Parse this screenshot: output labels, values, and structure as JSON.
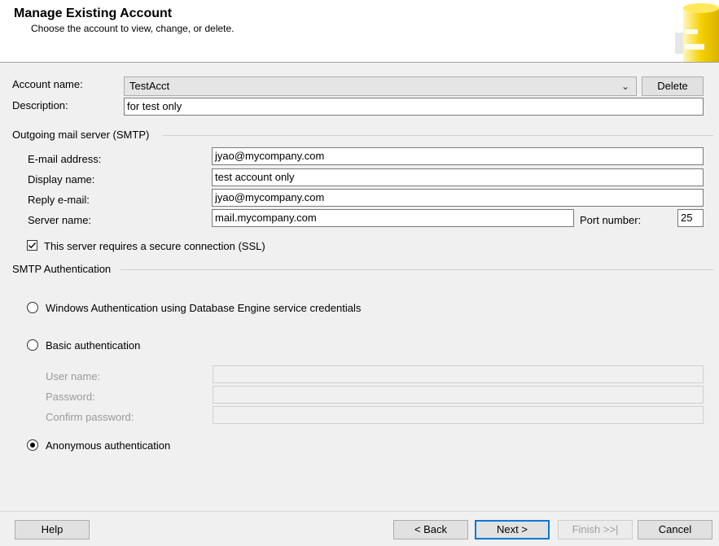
{
  "header": {
    "title": "Manage Existing Account",
    "subtitle": "Choose the account to view, change, or delete."
  },
  "account": {
    "name_label": "Account name:",
    "name_value": "TestAcct",
    "delete_label": "Delete",
    "description_label": "Description:",
    "description_value": "for test only"
  },
  "smtp": {
    "group_title": "Outgoing mail server (SMTP)",
    "email_label": "E-mail address:",
    "email_value": "jyao@mycompany.com",
    "display_label": "Display name:",
    "display_value": "test account only",
    "reply_label": "Reply e-mail:",
    "reply_value": "jyao@mycompany.com",
    "server_label": "Server name:",
    "server_value": "mail.mycompany.com",
    "port_label": "Port number:",
    "port_value": "25",
    "ssl_label": "This server requires a secure connection (SSL)",
    "ssl_checked": true
  },
  "auth": {
    "group_title": "SMTP Authentication",
    "windows_label": "Windows Authentication using Database Engine service credentials",
    "basic_label": "Basic authentication",
    "username_label": "User name:",
    "password_label": "Password:",
    "confirm_label": "Confirm password:",
    "anonymous_label": "Anonymous authentication",
    "selected": "anonymous"
  },
  "footer": {
    "help": "Help",
    "back": "< Back",
    "next": "Next >",
    "finish": "Finish >>|",
    "cancel": "Cancel"
  },
  "colors": {
    "logo": "#f5d000",
    "default_button_border": "#0078d7"
  }
}
